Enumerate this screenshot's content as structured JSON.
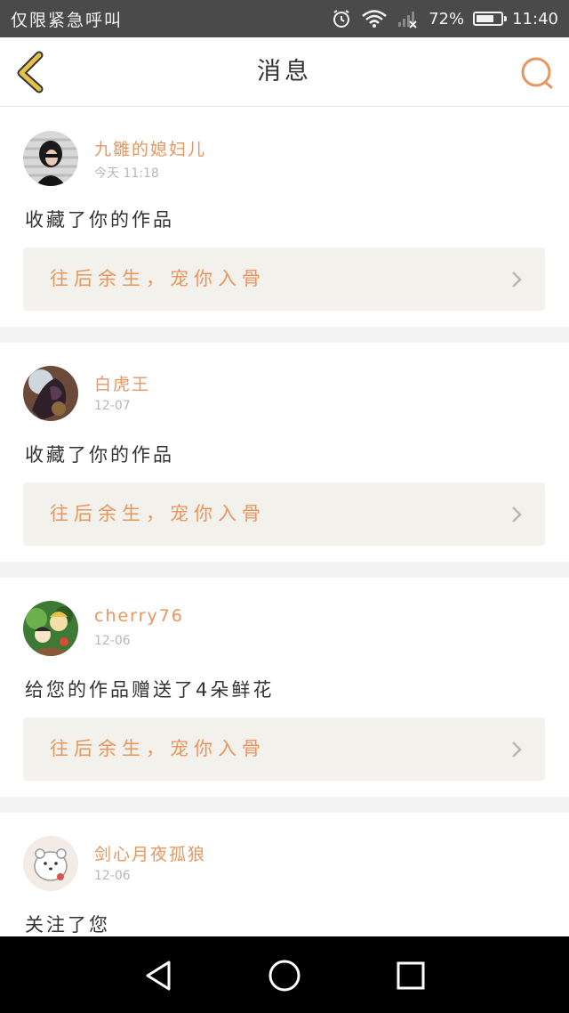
{
  "status_bar": {
    "carrier": "仅限紧急呼叫",
    "battery_text": "72%",
    "battery_level": 0.72,
    "time": "11:40"
  },
  "header": {
    "title": "消息",
    "back_icon": "chevron-left-icon",
    "search_icon": "search-icon"
  },
  "colors": {
    "accent": "#e8955e",
    "back_arrow": "#e4c24a",
    "link_bg": "#f3f1ec"
  },
  "notifications": [
    {
      "user": "九雛的媳妇儿",
      "time": "今天 11:18",
      "action": "收藏了你的作品",
      "work": "往后余生，宠你入骨"
    },
    {
      "user": "白虎王",
      "time": "12-07",
      "action": "收藏了你的作品",
      "work": "往后余生，宠你入骨"
    },
    {
      "user": "cherry76",
      "time": "12-06",
      "action": "给您的作品赠送了4朵鲜花",
      "work": "往后余生，宠你入骨"
    },
    {
      "user": "剑心月夜孤狼",
      "time": "12-06",
      "action": "关注了您"
    }
  ],
  "nav_bar": {
    "back": "triangle-back-icon",
    "home": "circle-home-icon",
    "recents": "square-recents-icon"
  }
}
